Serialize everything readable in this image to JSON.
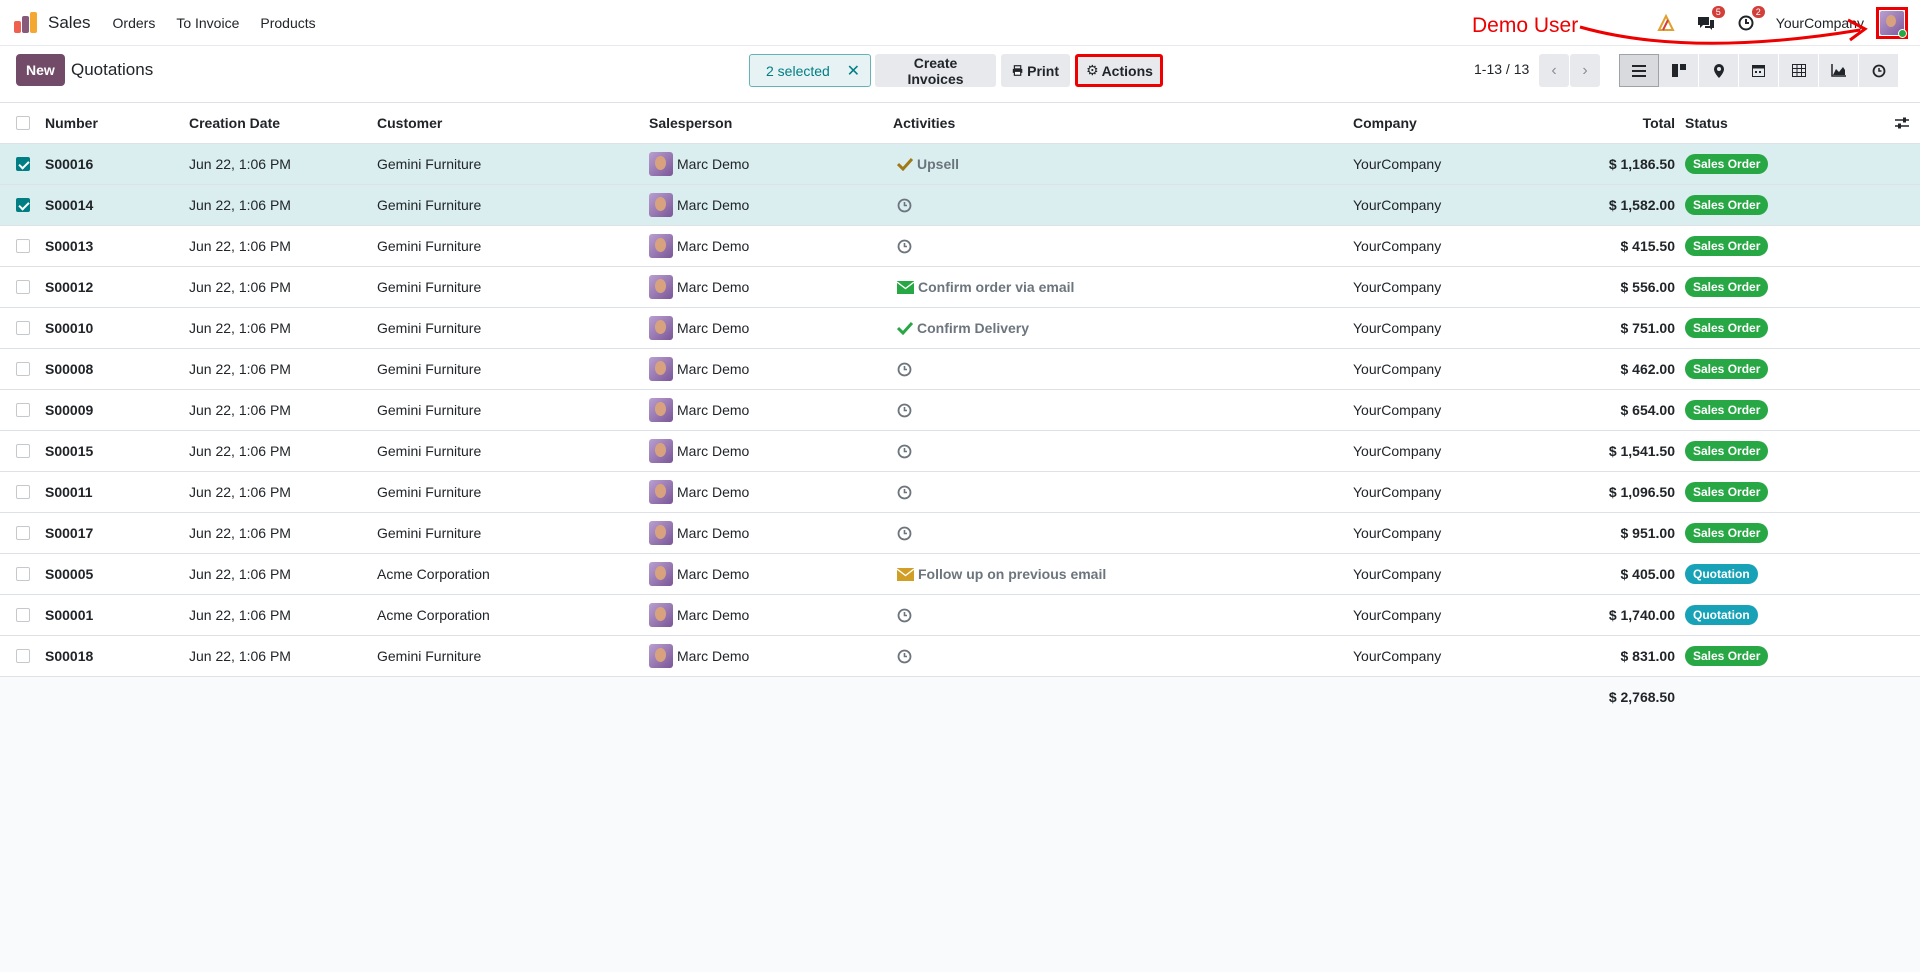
{
  "nav": {
    "brand": "Sales",
    "menu": [
      "Orders",
      "To Invoice",
      "Products"
    ],
    "messages_badge": "5",
    "activities_badge": "2",
    "company": "YourCompany"
  },
  "annotation": {
    "label": "Demo User",
    "color": "#e00000"
  },
  "control": {
    "new_label": "New",
    "title": "Quotations",
    "selected_label": "2 selected",
    "create_invoices_label": "Create Invoices",
    "print_label": "Print",
    "actions_label": "Actions",
    "pager": "1-13 / 13"
  },
  "table": {
    "headers": {
      "number": "Number",
      "creation_date": "Creation Date",
      "customer": "Customer",
      "salesperson": "Salesperson",
      "activities": "Activities",
      "company": "Company",
      "total": "Total",
      "status": "Status"
    },
    "rows": [
      {
        "selected": true,
        "number": "S00016",
        "date": "Jun 22, 1:06 PM",
        "customer": "Gemini Furniture",
        "salesperson": "Marc Demo",
        "activity_icon": "check-icon",
        "activity_color": "#a07a16",
        "activity": "Upsell",
        "company": "YourCompany",
        "total": "$ 1,186.50",
        "status": "Sales Order",
        "status_kind": "so"
      },
      {
        "selected": true,
        "number": "S00014",
        "date": "Jun 22, 1:06 PM",
        "customer": "Gemini Furniture",
        "salesperson": "Marc Demo",
        "activity_icon": "clock-icon",
        "activity_color": "#6c757d",
        "activity": "",
        "company": "YourCompany",
        "total": "$ 1,582.00",
        "status": "Sales Order",
        "status_kind": "so"
      },
      {
        "selected": false,
        "number": "S00013",
        "date": "Jun 22, 1:06 PM",
        "customer": "Gemini Furniture",
        "salesperson": "Marc Demo",
        "activity_icon": "clock-icon",
        "activity_color": "#6c757d",
        "activity": "",
        "company": "YourCompany",
        "total": "$ 415.50",
        "status": "Sales Order",
        "status_kind": "so"
      },
      {
        "selected": false,
        "number": "S00012",
        "date": "Jun 22, 1:06 PM",
        "customer": "Gemini Furniture",
        "salesperson": "Marc Demo",
        "activity_icon": "envelope-icon",
        "activity_color": "#28a745",
        "activity": "Confirm order via email",
        "company": "YourCompany",
        "total": "$ 556.00",
        "status": "Sales Order",
        "status_kind": "so"
      },
      {
        "selected": false,
        "number": "S00010",
        "date": "Jun 22, 1:06 PM",
        "customer": "Gemini Furniture",
        "salesperson": "Marc Demo",
        "activity_icon": "check-icon",
        "activity_color": "#28a745",
        "activity": "Confirm Delivery",
        "company": "YourCompany",
        "total": "$ 751.00",
        "status": "Sales Order",
        "status_kind": "so"
      },
      {
        "selected": false,
        "number": "S00008",
        "date": "Jun 22, 1:06 PM",
        "customer": "Gemini Furniture",
        "salesperson": "Marc Demo",
        "activity_icon": "clock-icon",
        "activity_color": "#6c757d",
        "activity": "",
        "company": "YourCompany",
        "total": "$ 462.00",
        "status": "Sales Order",
        "status_kind": "so"
      },
      {
        "selected": false,
        "number": "S00009",
        "date": "Jun 22, 1:06 PM",
        "customer": "Gemini Furniture",
        "salesperson": "Marc Demo",
        "activity_icon": "clock-icon",
        "activity_color": "#6c757d",
        "activity": "",
        "company": "YourCompany",
        "total": "$ 654.00",
        "status": "Sales Order",
        "status_kind": "so"
      },
      {
        "selected": false,
        "number": "S00015",
        "date": "Jun 22, 1:06 PM",
        "customer": "Gemini Furniture",
        "salesperson": "Marc Demo",
        "activity_icon": "clock-icon",
        "activity_color": "#6c757d",
        "activity": "",
        "company": "YourCompany",
        "total": "$ 1,541.50",
        "status": "Sales Order",
        "status_kind": "so"
      },
      {
        "selected": false,
        "number": "S00011",
        "date": "Jun 22, 1:06 PM",
        "customer": "Gemini Furniture",
        "salesperson": "Marc Demo",
        "activity_icon": "clock-icon",
        "activity_color": "#6c757d",
        "activity": "",
        "company": "YourCompany",
        "total": "$ 1,096.50",
        "status": "Sales Order",
        "status_kind": "so"
      },
      {
        "selected": false,
        "number": "S00017",
        "date": "Jun 22, 1:06 PM",
        "customer": "Gemini Furniture",
        "salesperson": "Marc Demo",
        "activity_icon": "clock-icon",
        "activity_color": "#6c757d",
        "activity": "",
        "company": "YourCompany",
        "total": "$ 951.00",
        "status": "Sales Order",
        "status_kind": "so"
      },
      {
        "selected": false,
        "number": "S00005",
        "date": "Jun 22, 1:06 PM",
        "customer": "Acme Corporation",
        "salesperson": "Marc Demo",
        "activity_icon": "envelope-icon",
        "activity_color": "#d19e26",
        "activity": "Follow up on previous email",
        "company": "YourCompany",
        "total": "$ 405.00",
        "status": "Quotation",
        "status_kind": "q"
      },
      {
        "selected": false,
        "number": "S00001",
        "date": "Jun 22, 1:06 PM",
        "customer": "Acme Corporation",
        "salesperson": "Marc Demo",
        "activity_icon": "clock-icon",
        "activity_color": "#6c757d",
        "activity": "",
        "company": "YourCompany",
        "total": "$ 1,740.00",
        "status": "Quotation",
        "status_kind": "q"
      },
      {
        "selected": false,
        "number": "S00018",
        "date": "Jun 22, 1:06 PM",
        "customer": "Gemini Furniture",
        "salesperson": "Marc Demo",
        "activity_icon": "clock-icon",
        "activity_color": "#6c757d",
        "activity": "",
        "company": "YourCompany",
        "total": "$ 831.00",
        "status": "Sales Order",
        "status_kind": "so"
      }
    ],
    "footer_total": "$ 2,768.50"
  }
}
